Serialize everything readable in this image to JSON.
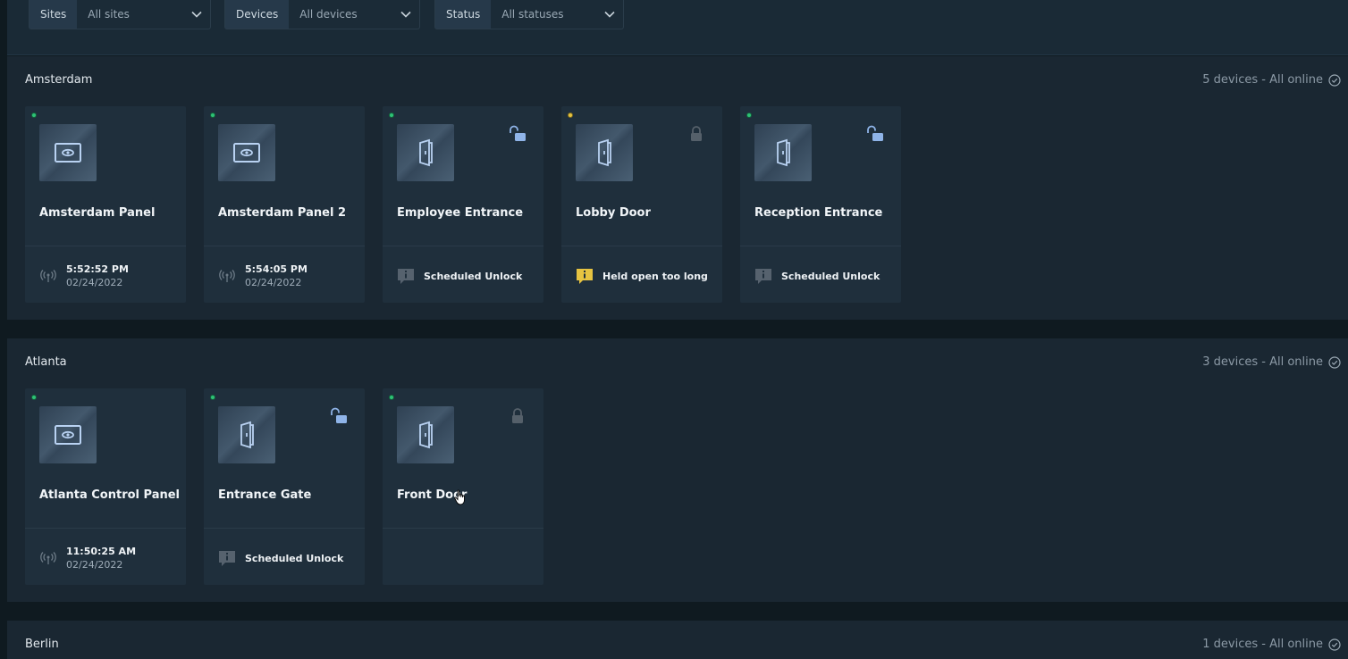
{
  "filters": {
    "sites": {
      "label": "Sites",
      "value": "All sites"
    },
    "devices": {
      "label": "Devices",
      "value": "All devices"
    },
    "status": {
      "label": "Status",
      "value": "All statuses"
    }
  },
  "sections": [
    {
      "title": "Amsterdam",
      "status": "5 devices - All online",
      "cards": [
        {
          "name": "Amsterdam Panel",
          "type": "panel",
          "state": "online",
          "time": "5:52:52 PM",
          "date": "02/24/2022"
        },
        {
          "name": "Amsterdam Panel 2",
          "type": "panel",
          "state": "online",
          "time": "5:54:05 PM",
          "date": "02/24/2022"
        },
        {
          "name": "Employee Entrance",
          "type": "door",
          "state": "online",
          "lock": "unlocked",
          "message": "Scheduled Unlock",
          "message_level": "info"
        },
        {
          "name": "Lobby Door",
          "type": "door",
          "state": "warning",
          "lock": "locked",
          "message": "Held open too long",
          "message_level": "warning"
        },
        {
          "name": "Reception Entrance",
          "type": "door",
          "state": "online",
          "lock": "unlocked",
          "message": "Scheduled Unlock",
          "message_level": "info"
        }
      ]
    },
    {
      "title": "Atlanta",
      "status": "3 devices - All online",
      "cards": [
        {
          "name": "Atlanta Control Panel",
          "type": "panel",
          "state": "online",
          "time": "11:50:25 AM",
          "date": "02/24/2022"
        },
        {
          "name": "Entrance Gate",
          "type": "door",
          "state": "online",
          "lock": "unlocked",
          "message": "Scheduled Unlock",
          "message_level": "info"
        },
        {
          "name": "Front Door",
          "type": "door",
          "state": "online",
          "lock": "locked",
          "message": "",
          "message_level": "none"
        }
      ]
    },
    {
      "title": "Berlin",
      "status": "1 devices - All online",
      "cards": []
    }
  ],
  "colors": {
    "online": "#2ec276",
    "warning": "#e6c341",
    "unlock_blue": "#8fb4e8",
    "lock_gray": "#55606a"
  }
}
